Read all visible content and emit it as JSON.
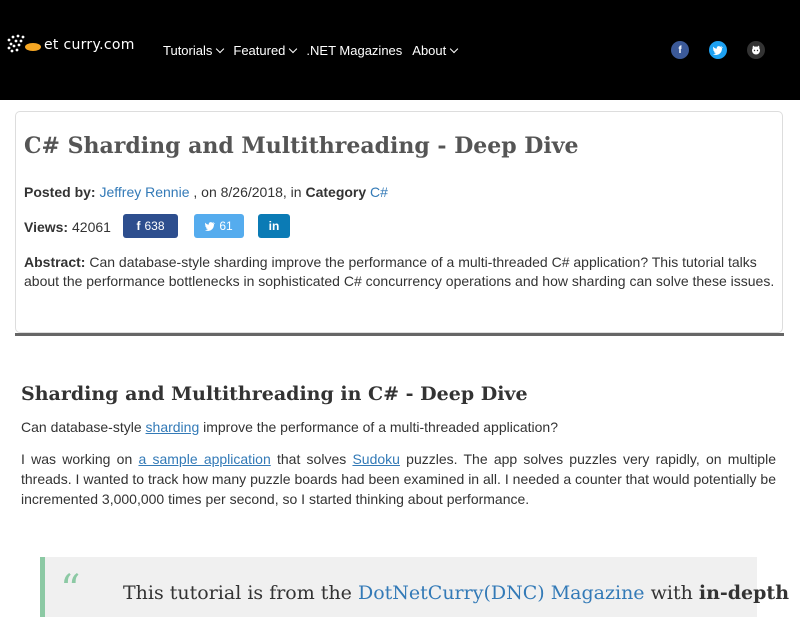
{
  "header": {
    "logo_text": "et curry.com",
    "nav": [
      "Tutorials",
      "Featured",
      ".NET Magazines",
      "About"
    ],
    "social": {
      "facebook": "f",
      "twitter": "t",
      "github": "g"
    }
  },
  "article": {
    "title": "C# Sharding and Multithreading - Deep Dive",
    "posted_by_label": "Posted by:",
    "author": "Jeffrey Rennie",
    "date_text": ", on 8/26/2018, in",
    "category_label": "Category",
    "category": "C#",
    "views_label": "Views:",
    "views": "42061",
    "share_facebook": "638",
    "share_twitter": "61",
    "share_linkedin": "in",
    "abstract_label": "Abstract:",
    "abstract_text": "Can database-style sharding improve the performance of a multi-threaded C# application? This tutorial talks about the performance bottlenecks in sophisticated C# concurrency operations and how sharding can solve these issues."
  },
  "body": {
    "heading": "Sharding and Multithreading in C# - Deep Dive",
    "p1_pre": "Can database-style ",
    "p1_link": "sharding",
    "p1_post": " improve the performance of a multi-threaded application?",
    "p2_a": "I was working on ",
    "p2_link1": "a sample application",
    "p2_b": " that solves ",
    "p2_link2": "Sudoku",
    "p2_c": " puzzles. The app solves puzzles very rapidly, on multiple threads. I wanted to track how many puzzle boards had been examined in all. I needed a counter that would potentially be incremented 3,000,000 times per second, so I started thinking about performance.",
    "quote_mark": "“",
    "quote_pre": "This tutorial is from the ",
    "quote_link": "DotNetCurry(DNC) Magazine",
    "quote_post": " with ",
    "quote_bold": "in-depth"
  }
}
